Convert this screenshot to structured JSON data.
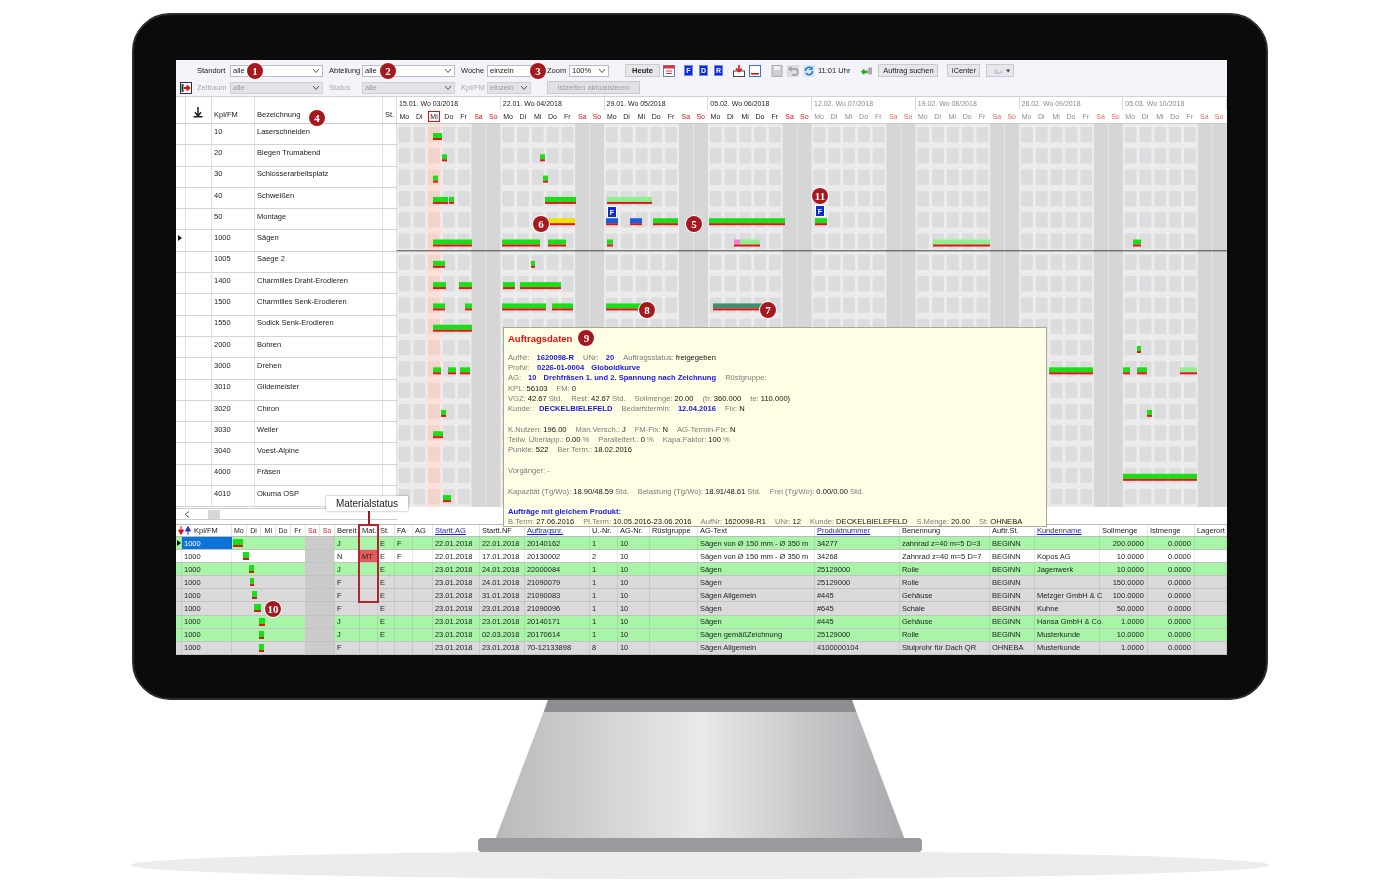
{
  "toolbar": {
    "filters_row1": [
      {
        "label": "Standort",
        "value": "alle",
        "kind": "dropdown",
        "disabled": false
      },
      {
        "label": "Abteilung",
        "value": "alle",
        "kind": "dropdown",
        "disabled": false
      },
      {
        "label": "Woche",
        "value": "einzeln",
        "kind": "field",
        "disabled": false
      }
    ],
    "zoom": {
      "label": "Zoom",
      "value": "100%"
    },
    "today_button": "Heute",
    "filter_buttons": [
      "F",
      "D",
      "R"
    ],
    "time": "11:01 Uhr",
    "search_button": "Auftrag suchen",
    "icenter_button": "iCenter",
    "filters_row2": [
      {
        "label": "Zeitraum",
        "value": "alle",
        "kind": "dropdown",
        "disabled": true
      },
      {
        "label": "Status",
        "value": "alle",
        "kind": "dropdown",
        "disabled": true
      },
      {
        "label": "Kpl/FM",
        "value": "einzeln",
        "kind": "dropdown",
        "disabled": true
      }
    ],
    "refresh_button": {
      "label": "Istzeiten aktualisieren",
      "disabled": true
    }
  },
  "work_centers": {
    "columns": [
      "Kpl/FM",
      "Bezeichnung",
      "St."
    ],
    "rows": [
      {
        "code": "10",
        "name": "Laserschneiden",
        "selected": false
      },
      {
        "code": "20",
        "name": "Biegen Trumabend",
        "selected": false
      },
      {
        "code": "30",
        "name": "Schlosserarbeitsplatz",
        "selected": false
      },
      {
        "code": "40",
        "name": "Schweißen",
        "selected": false
      },
      {
        "code": "50",
        "name": "Montage",
        "selected": false
      },
      {
        "code": "1000",
        "name": "Sägen",
        "selected": true
      },
      {
        "code": "1005",
        "name": "Saege 2",
        "selected": false
      },
      {
        "code": "1400",
        "name": "Charmilles Draht-Erodieren",
        "selected": false
      },
      {
        "code": "1500",
        "name": "Charmilles Senk-Erodieren",
        "selected": false
      },
      {
        "code": "1550",
        "name": "Sodick Senk-Erodieren",
        "selected": false
      },
      {
        "code": "2000",
        "name": "Bohren",
        "selected": false
      },
      {
        "code": "3000",
        "name": "Drehen",
        "selected": false
      },
      {
        "code": "3010",
        "name": "Gildemeister",
        "selected": false
      },
      {
        "code": "3020",
        "name": "Chiron",
        "selected": false
      },
      {
        "code": "3030",
        "name": "Weiler",
        "selected": false
      },
      {
        "code": "3040",
        "name": "Voest-Alpine",
        "selected": false
      },
      {
        "code": "4000",
        "name": "Fräsen",
        "selected": false
      },
      {
        "code": "4010",
        "name": "Okuma OSP",
        "selected": false
      }
    ]
  },
  "schedule": {
    "weeks": [
      {
        "label": "15.01. Wo 03/2018",
        "dimmed": false,
        "days": [
          {
            "label": "Mo",
            "weekend": false,
            "today": false
          },
          {
            "label": "Di",
            "weekend": false,
            "today": false
          },
          {
            "label": "Mi",
            "weekend": false,
            "today": true
          },
          {
            "label": "Do",
            "weekend": false,
            "today": false
          },
          {
            "label": "Fr",
            "weekend": false,
            "today": false
          },
          {
            "label": "Sa",
            "weekend": true,
            "today": false
          },
          {
            "label": "So",
            "weekend": true,
            "today": false
          }
        ]
      },
      {
        "label": "22.01. Wo 04/2018",
        "dimmed": false,
        "days": [
          {
            "label": "Mo",
            "weekend": false,
            "today": false
          },
          {
            "label": "Di",
            "weekend": false,
            "today": false
          },
          {
            "label": "Mi",
            "weekend": false,
            "today": false
          },
          {
            "label": "Do",
            "weekend": false,
            "today": false
          },
          {
            "label": "Fr",
            "weekend": false,
            "today": false
          },
          {
            "label": "Sa",
            "weekend": true,
            "today": false
          },
          {
            "label": "So",
            "weekend": true,
            "today": false
          }
        ]
      },
      {
        "label": "29.01. Wo 05/2018",
        "dimmed": false,
        "days": [
          {
            "label": "Mo",
            "weekend": false,
            "today": false
          },
          {
            "label": "Di",
            "weekend": false,
            "today": false
          },
          {
            "label": "Mi",
            "weekend": false,
            "today": false
          },
          {
            "label": "Do",
            "weekend": false,
            "today": false
          },
          {
            "label": "Fr",
            "weekend": false,
            "today": false
          },
          {
            "label": "Sa",
            "weekend": true,
            "today": false
          },
          {
            "label": "So",
            "weekend": true,
            "today": false
          }
        ]
      },
      {
        "label": "05.02. Wo 06/2018",
        "dimmed": false,
        "days": [
          {
            "label": "Mo",
            "weekend": false,
            "today": false
          },
          {
            "label": "Di",
            "weekend": false,
            "today": false
          },
          {
            "label": "Mi",
            "weekend": false,
            "today": false
          },
          {
            "label": "Do",
            "weekend": false,
            "today": false
          },
          {
            "label": "Fr",
            "weekend": false,
            "today": false
          },
          {
            "label": "Sa",
            "weekend": true,
            "today": false
          },
          {
            "label": "So",
            "weekend": true,
            "today": false
          }
        ]
      },
      {
        "label": "12.02. Wo 07/2018",
        "dimmed": true,
        "days": [
          {
            "label": "Mo",
            "weekend": false,
            "today": false
          },
          {
            "label": "Di",
            "weekend": false,
            "today": false
          },
          {
            "label": "Mi",
            "weekend": false,
            "today": false
          },
          {
            "label": "Do",
            "weekend": false,
            "today": false
          },
          {
            "label": "Fr",
            "weekend": false,
            "today": false
          },
          {
            "label": "Sa",
            "weekend": true,
            "today": false
          },
          {
            "label": "So",
            "weekend": true,
            "today": false
          }
        ]
      },
      {
        "label": "19.02. Wo 08/2018",
        "dimmed": true,
        "days": [
          {
            "label": "Mo",
            "weekend": false,
            "today": false
          },
          {
            "label": "Di",
            "weekend": false,
            "today": false
          },
          {
            "label": "Mi",
            "weekend": false,
            "today": false
          },
          {
            "label": "Do",
            "weekend": false,
            "today": false
          },
          {
            "label": "Fr",
            "weekend": false,
            "today": false
          },
          {
            "label": "Sa",
            "weekend": true,
            "today": false
          },
          {
            "label": "So",
            "weekend": true,
            "today": false
          }
        ]
      },
      {
        "label": "26.02. Wo 09/2018",
        "dimmed": true,
        "days": [
          {
            "label": "Mo",
            "weekend": false,
            "today": false
          },
          {
            "label": "Di",
            "weekend": false,
            "today": false
          },
          {
            "label": "Mi",
            "weekend": false,
            "today": false
          },
          {
            "label": "Do",
            "weekend": false,
            "today": false
          },
          {
            "label": "Fr",
            "weekend": false,
            "today": false
          },
          {
            "label": "Sa",
            "weekend": true,
            "today": false
          },
          {
            "label": "So",
            "weekend": true,
            "today": false
          }
        ]
      },
      {
        "label": "05.03. Wo 10/2018",
        "dimmed": true,
        "days": [
          {
            "label": "Mo",
            "weekend": false,
            "today": false
          },
          {
            "label": "Di",
            "weekend": false,
            "today": false
          },
          {
            "label": "Mi",
            "weekend": false,
            "today": false
          },
          {
            "label": "Do",
            "weekend": false,
            "today": false
          },
          {
            "label": "Fr",
            "weekend": false,
            "today": false
          },
          {
            "label": "Sa",
            "weekend": true,
            "today": false
          },
          {
            "label": "So",
            "weekend": true,
            "today": false
          }
        ]
      }
    ],
    "badges": [
      "F",
      "F"
    ]
  },
  "callouts": [
    "1",
    "2",
    "3",
    "4",
    "5",
    "6",
    "7",
    "8",
    "10",
    "11"
  ],
  "tooltip": {
    "title": "Auftragsdaten",
    "marker": "9",
    "sections": [
      [
        [
          {
            "kind": "label",
            "text": "AufNr:"
          },
          {
            "kind": "link",
            "text": "1620098-R"
          },
          {
            "kind": "label",
            "text": "UNr:"
          },
          {
            "kind": "link",
            "text": "20"
          },
          {
            "kind": "label",
            "text": "Auftragsstatus:"
          },
          {
            "kind": "value",
            "text": "freigegeben"
          }
        ],
        [
          {
            "kind": "label",
            "text": "ProNr:"
          },
          {
            "kind": "link",
            "text": "0226-01-0004"
          },
          {
            "kind": "link",
            "text": "Globoidkurve"
          }
        ],
        [
          {
            "kind": "label",
            "text": "AG:"
          },
          {
            "kind": "link",
            "text": "10"
          },
          {
            "kind": "link",
            "text": "Drehfräsen 1. und 2. Spannung nach Zeichnung"
          },
          {
            "kind": "label",
            "text": "Rüstgruppe:"
          }
        ],
        [
          {
            "kind": "label",
            "text": "KPL:"
          },
          {
            "kind": "value",
            "text": "56103"
          },
          {
            "kind": "label",
            "text": "FM:"
          },
          {
            "kind": "value",
            "text": "0"
          }
        ],
        [
          {
            "kind": "label",
            "text": "VGZ:"
          },
          {
            "kind": "value",
            "text": "42.67"
          },
          {
            "kind": "unit",
            "text": "Std."
          },
          {
            "kind": "label",
            "text": "Rest:"
          },
          {
            "kind": "value",
            "text": "42.67"
          },
          {
            "kind": "unit",
            "text": "Std."
          },
          {
            "kind": "label",
            "text": "Sollmenge:"
          },
          {
            "kind": "value",
            "text": "20.00"
          },
          {
            "kind": "label",
            "text": "(tr:"
          },
          {
            "kind": "value",
            "text": "360.000"
          },
          {
            "kind": "label",
            "text": "te:"
          },
          {
            "kind": "value",
            "text": "110.000)"
          }
        ],
        [
          {
            "kind": "label",
            "text": "Kunde:"
          },
          {
            "kind": "link",
            "text": "DECKELBIELEFELD"
          },
          {
            "kind": "label",
            "text": "Bedarfstermin:"
          },
          {
            "kind": "link",
            "text": "12.04.2016"
          },
          {
            "kind": "label",
            "text": "Fix:"
          },
          {
            "kind": "value",
            "text": "N"
          }
        ]
      ],
      [
        [
          {
            "kind": "label",
            "text": "K.Nutzen:"
          },
          {
            "kind": "value",
            "text": "196.00"
          },
          {
            "kind": "label",
            "text": "Man.Versch.:"
          },
          {
            "kind": "value",
            "text": "J"
          },
          {
            "kind": "label",
            "text": "FM-Fix:"
          },
          {
            "kind": "value",
            "text": "N"
          },
          {
            "kind": "label",
            "text": "AG-Termin-Fix:"
          },
          {
            "kind": "value",
            "text": "N"
          }
        ],
        [
          {
            "kind": "label",
            "text": "Teilw. Überlapp.:"
          },
          {
            "kind": "value",
            "text": "0.00"
          },
          {
            "kind": "unit",
            "text": "%"
          },
          {
            "kind": "label",
            "text": "Parallelfert.:"
          },
          {
            "kind": "value",
            "text": "0"
          },
          {
            "kind": "unit",
            "text": "%"
          },
          {
            "kind": "label",
            "text": "Kapa.Faktor:"
          },
          {
            "kind": "value",
            "text": "100"
          },
          {
            "kind": "unit",
            "text": "%"
          }
        ],
        [
          {
            "kind": "label",
            "text": "Punkte:"
          },
          {
            "kind": "value",
            "text": "522"
          },
          {
            "kind": "label",
            "text": "Ber.Term.:"
          },
          {
            "kind": "value",
            "text": "18.02.2016"
          }
        ]
      ],
      [
        [
          {
            "kind": "label",
            "text": "Vorgänger: -"
          }
        ]
      ],
      [
        [
          {
            "kind": "label",
            "text": "Kapazität (Tg/Wo):"
          },
          {
            "kind": "value",
            "text": "18.90/48.59"
          },
          {
            "kind": "unit",
            "text": "Std."
          },
          {
            "kind": "label",
            "text": "Belastung (Tg/Wo):"
          },
          {
            "kind": "value",
            "text": "18.91/48.61"
          },
          {
            "kind": "unit",
            "text": "Std."
          },
          {
            "kind": "label",
            "text": "Frei (Tg/Wo):"
          },
          {
            "kind": "value",
            "text": "0.00/0.00"
          },
          {
            "kind": "unit",
            "text": "Std."
          }
        ]
      ]
    ],
    "related_heading": "Aufträge mit gleichem Produkt:",
    "related_line": [
      {
        "kind": "label",
        "text": "B.Term:"
      },
      {
        "kind": "value",
        "text": "27.06.2016"
      },
      {
        "kind": "label",
        "text": "Pl.Term:"
      },
      {
        "kind": "value",
        "text": "10.05.2016-23.06.2016"
      },
      {
        "kind": "label",
        "text": "AufNr:"
      },
      {
        "kind": "value",
        "text": "1620098-R1"
      },
      {
        "kind": "label",
        "text": "UNr:"
      },
      {
        "kind": "value",
        "text": "12"
      },
      {
        "kind": "label",
        "text": "Kunde:"
      },
      {
        "kind": "value",
        "text": "DECKELBIELEFELD"
      },
      {
        "kind": "label",
        "text": "S.Menge:"
      },
      {
        "kind": "value",
        "text": "20.00"
      },
      {
        "kind": "label",
        "text": "St:"
      },
      {
        "kind": "value",
        "text": "OHNEBA"
      }
    ]
  },
  "orders": {
    "columns": [
      {
        "label": "Kpl/FM",
        "link": false
      },
      {
        "label": "Bereit",
        "link": false
      },
      {
        "label": "Mat.",
        "link": false
      },
      {
        "label": "St.",
        "link": false
      },
      {
        "label": "FA",
        "link": false
      },
      {
        "label": "AG",
        "link": false
      },
      {
        "label": "Startt.AG",
        "link": true
      },
      {
        "label": "Startt.NF",
        "link": false
      },
      {
        "label": "Auftragsnr.",
        "link": true
      },
      {
        "label": "U.-Nr.",
        "link": false
      },
      {
        "label": "AG-Nr.",
        "link": false
      },
      {
        "label": "Rüstgruppe",
        "link": false
      },
      {
        "label": "AG-Text",
        "link": false
      },
      {
        "label": "Produktnummer",
        "link": true
      },
      {
        "label": "Benennung",
        "link": false
      },
      {
        "label": "Auftr.St.",
        "link": false
      },
      {
        "label": "Kundenname",
        "link": true
      },
      {
        "label": "Sollmenge",
        "link": false
      },
      {
        "label": "Istmenge",
        "link": false
      },
      {
        "label": "Lagerort",
        "link": false
      }
    ],
    "day_columns": [
      {
        "label": "Mo",
        "weekend": false
      },
      {
        "label": "Di",
        "weekend": false
      },
      {
        "label": "Mi",
        "weekend": false
      },
      {
        "label": "Do",
        "weekend": false
      },
      {
        "label": "Fr",
        "weekend": false
      },
      {
        "label": "Sa",
        "weekend": true
      },
      {
        "label": "So",
        "weekend": true
      }
    ],
    "rows": [
      {
        "selected": true,
        "color": "#a8f5a8",
        "mat_alert": false,
        "kpl": "1000",
        "bereit": "J",
        "st": "E",
        "fa": "F",
        "startt_ag": "22.01.2018",
        "startt_nf": "22.01.2018",
        "auftragsnr": "20140162",
        "u_nr": "1",
        "ag_nr": "10",
        "ag_text": "Sägen von Ø 150 mm - Ø 350 m",
        "produktnummer": "34277",
        "benennung": "zahnrad z=40 m=5 D=3",
        "auftr_st": "BEGINN",
        "sollmenge": "200.0000",
        "istmenge": "0.0000"
      },
      {
        "selected": false,
        "color": "#ffffff",
        "mat_alert": true,
        "kpl": "1000",
        "bereit": "N",
        "mat": "MT",
        "st": "E",
        "fa": "F",
        "startt_ag": "22.01.2018",
        "startt_nf": "17.01.2018",
        "auftragsnr": "20130002",
        "u_nr": "2",
        "ag_nr": "10",
        "ag_text": "Sägen von Ø 150 mm - Ø 350 m",
        "produktnummer": "34268",
        "benennung": "Zahnrad z=40 m=5 D=7",
        "auftr_st": "BEGINN",
        "kundenname": "Kopos AG",
        "sollmenge": "10.0000",
        "istmenge": "0.0000"
      },
      {
        "selected": false,
        "color": "#a8f5a8",
        "mat_alert": false,
        "kpl": "1000",
        "bereit": "J",
        "st": "E",
        "startt_ag": "23.01.2018",
        "startt_nf": "24.01.2018",
        "auftragsnr": "22000084",
        "u_nr": "1",
        "ag_nr": "10",
        "ag_text": "Sägen",
        "produktnummer": "25129000",
        "benennung": "Rolle",
        "auftr_st": "BEGINN",
        "kundenname": "Jagenwerk",
        "sollmenge": "10.0000",
        "istmenge": "0.0000"
      },
      {
        "selected": false,
        "color": "#dadada",
        "mat_alert": false,
        "kpl": "1000",
        "bereit": "F",
        "st": "E",
        "startt_ag": "23.01.2018",
        "startt_nf": "24.01.2018",
        "auftragsnr": "21090079",
        "u_nr": "1",
        "ag_nr": "10",
        "ag_text": "Sägen",
        "produktnummer": "25129000",
        "benennung": "Rolle",
        "auftr_st": "BEGINN",
        "sollmenge": "150.0000",
        "istmenge": "0.0000"
      },
      {
        "selected": false,
        "color": "#dadada",
        "mat_alert": false,
        "kpl": "1000",
        "bereit": "F",
        "st": "E",
        "startt_ag": "23.01.2018",
        "startt_nf": "31.01.2018",
        "auftragsnr": "21090083",
        "u_nr": "1",
        "ag_nr": "10",
        "ag_text": "Sägen Allgemein",
        "produktnummer": "#445",
        "benennung": "Gehäuse",
        "auftr_st": "BEGINN",
        "kundenname": "Metzger GmbH & C",
        "sollmenge": "100.0000",
        "istmenge": "0.0000"
      },
      {
        "selected": false,
        "color": "#dadada",
        "mat_alert": false,
        "kpl": "1000",
        "bereit": "F",
        "st": "E",
        "startt_ag": "23.01.2018",
        "startt_nf": "23.01.2018",
        "auftragsnr": "21090096",
        "u_nr": "1",
        "ag_nr": "10",
        "ag_text": "Sägen",
        "produktnummer": "#645",
        "benennung": "Schale",
        "auftr_st": "BEGINN",
        "kundenname": "Kuhne",
        "sollmenge": "50.0000",
        "istmenge": "0.0000"
      },
      {
        "selected": false,
        "color": "#a8f5a8",
        "mat_alert": false,
        "kpl": "1000",
        "bereit": "J",
        "st": "E",
        "startt_ag": "23.01.2018",
        "startt_nf": "23.01.2018",
        "auftragsnr": "20140171",
        "u_nr": "1",
        "ag_nr": "10",
        "ag_text": "Sägen",
        "produktnummer": "#445",
        "benennung": "Gehäuse",
        "auftr_st": "BEGINN",
        "kundenname": "Hansa GmbH & Co.",
        "sollmenge": "1.0000",
        "istmenge": "0.0000"
      },
      {
        "selected": false,
        "color": "#a8f5a8",
        "mat_alert": false,
        "kpl": "1000",
        "bereit": "J",
        "st": "E",
        "startt_ag": "23.01.2018",
        "startt_nf": "02.03.2018",
        "auftragsnr": "20170614",
        "u_nr": "1",
        "ag_nr": "10",
        "ag_text": "Sägen gemäßZeichnung",
        "produktnummer": "25129000",
        "benennung": "Rolle",
        "auftr_st": "BEGINN",
        "kundenname": "Musterkunde",
        "sollmenge": "10.0000",
        "istmenge": "0.0000"
      },
      {
        "selected": false,
        "color": "#dadada",
        "mat_alert": false,
        "kpl": "1000",
        "bereit": "F",
        "startt_ag": "23.01.2018",
        "startt_nf": "23.01.2018",
        "auftragsnr": "70-12133898",
        "u_nr": "8",
        "ag_nr": "10",
        "ag_text": "Sägen Allgemein",
        "produktnummer": "4100000104",
        "benennung": "Stulprohr für Dach QR",
        "auftr_st": "OHNEBA",
        "kundenname": "Musterkunde",
        "sollmenge": "1.0000",
        "istmenge": "0.0000"
      }
    ]
  },
  "annotation": {
    "label": "Materialstatus"
  }
}
